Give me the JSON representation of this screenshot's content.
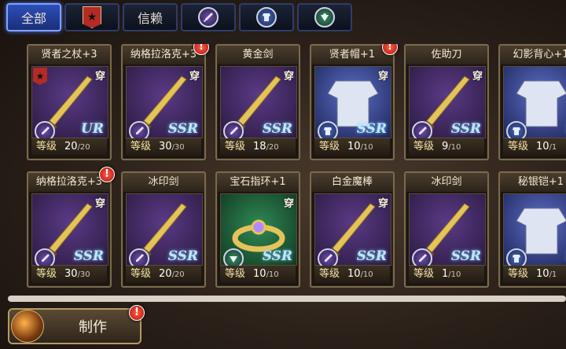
{
  "tabs": [
    {
      "label": "全部",
      "icon": null,
      "active": true
    },
    {
      "label": "",
      "icon": "star-banner-icon",
      "active": false
    },
    {
      "label": "信赖",
      "icon": null,
      "active": false
    },
    {
      "label": "",
      "icon": "sword-icon",
      "active": false
    },
    {
      "label": "",
      "icon": "armor-icon",
      "active": false
    },
    {
      "label": "",
      "icon": "accessory-icon",
      "active": false
    }
  ],
  "items": [
    {
      "name": "贤者之杖+3",
      "level_label": "等级",
      "level": "20",
      "max": "/20",
      "wear": "穿",
      "rarity": "UR",
      "type": "weapon",
      "warn": false,
      "star": true
    },
    {
      "name": "纳格拉洛克+3",
      "level_label": "等级",
      "level": "30",
      "max": "/30",
      "wear": "穿",
      "rarity": "SSR",
      "type": "weapon",
      "warn": true,
      "star": false
    },
    {
      "name": "黄金剑",
      "level_label": "等级",
      "level": "18",
      "max": "/20",
      "wear": "穿",
      "rarity": "SSR",
      "type": "weapon",
      "warn": false,
      "star": false
    },
    {
      "name": "贤者帽+1",
      "level_label": "等级",
      "level": "10",
      "max": "/10",
      "wear": "穿",
      "rarity": "SSR",
      "type": "armor",
      "warn": true,
      "star": false
    },
    {
      "name": "佐助刀",
      "level_label": "等级",
      "level": "9",
      "max": "/10",
      "wear": "穿",
      "rarity": "SSR",
      "type": "weapon",
      "warn": false,
      "star": false
    },
    {
      "name": "幻影背心+1",
      "level_label": "等级",
      "level": "10",
      "max": "/1",
      "wear": "",
      "rarity": "S",
      "type": "armor",
      "warn": false,
      "star": false
    },
    {
      "name": "纳格拉洛克+3",
      "level_label": "等级",
      "level": "30",
      "max": "/30",
      "wear": "穿",
      "rarity": "SSR",
      "type": "weapon",
      "warn": true,
      "star": false
    },
    {
      "name": "冰印剑",
      "level_label": "等级",
      "level": "20",
      "max": "/20",
      "wear": "",
      "rarity": "SSR",
      "type": "weapon",
      "warn": false,
      "star": false
    },
    {
      "name": "宝石指环+1",
      "level_label": "等级",
      "level": "10",
      "max": "/10",
      "wear": "穿",
      "rarity": "SSR",
      "type": "accessory",
      "warn": false,
      "star": false
    },
    {
      "name": "白金魔棒",
      "level_label": "等级",
      "level": "10",
      "max": "/10",
      "wear": "穿",
      "rarity": "SSR",
      "type": "weapon",
      "warn": false,
      "star": false
    },
    {
      "name": "冰印剑",
      "level_label": "等级",
      "level": "1",
      "max": "/10",
      "wear": "",
      "rarity": "SSR",
      "type": "weapon",
      "warn": false,
      "star": false
    },
    {
      "name": "秘银铠+1",
      "level_label": "等级",
      "level": "10",
      "max": "/1",
      "wear": "",
      "rarity": "S",
      "type": "armor",
      "warn": false,
      "star": false
    }
  ],
  "make_button": {
    "label": "制作",
    "warn": "!"
  },
  "warn_glyph": "!"
}
